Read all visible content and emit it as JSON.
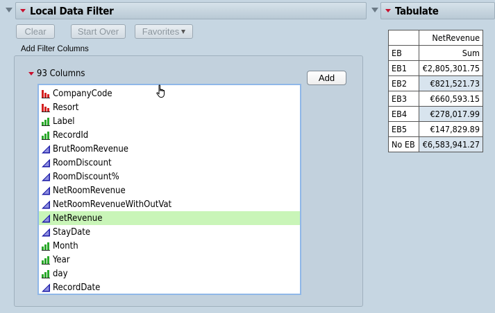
{
  "local_data_filter": {
    "title": "Local Data Filter",
    "buttons": {
      "clear": "Clear",
      "start_over": "Start Over",
      "favorites": "Favorites"
    },
    "add_filter_columns_label": "Add Filter Columns",
    "columns_header": "93 Columns",
    "add_button": "Add",
    "columns": [
      {
        "name": "CompanyCode",
        "type": "nominal-icon"
      },
      {
        "name": "Resort",
        "type": "nominal-icon"
      },
      {
        "name": "Label",
        "type": "ordinal-icon"
      },
      {
        "name": "RecordId",
        "type": "ordinal-icon"
      },
      {
        "name": "BrutRoomRevenue",
        "type": "continuous-icon"
      },
      {
        "name": "RoomDiscount",
        "type": "continuous-icon"
      },
      {
        "name": "RoomDiscount%",
        "type": "continuous-icon"
      },
      {
        "name": "NetRoomRevenue",
        "type": "continuous-icon"
      },
      {
        "name": "NetRoomRevenueWithOutVat",
        "type": "continuous-icon"
      },
      {
        "name": "NetRevenue",
        "type": "continuous-icon",
        "selected": true
      },
      {
        "name": "StayDate",
        "type": "continuous-icon"
      },
      {
        "name": "Month",
        "type": "ordinal-icon"
      },
      {
        "name": "Year",
        "type": "ordinal-icon"
      },
      {
        "name": "day",
        "type": "ordinal-icon"
      },
      {
        "name": "RecordDate",
        "type": "continuous-icon"
      }
    ]
  },
  "tabulate": {
    "title": "Tabulate",
    "column_header": "NetRevenue",
    "row_header": "EB",
    "stat_header": "Sum",
    "rows": [
      {
        "label": "EB1",
        "value": "€2,805,301.75"
      },
      {
        "label": "EB2",
        "value": "€821,521.73"
      },
      {
        "label": "EB3",
        "value": "€660,593.15"
      },
      {
        "label": "EB4",
        "value": "€278,017.99"
      },
      {
        "label": "EB5",
        "value": "€147,829.89"
      },
      {
        "label": "No EB",
        "value": "€6,583,941.27"
      }
    ]
  },
  "colors": {
    "background": "#c6d6e2",
    "selection": "#c9f5b8",
    "red_triangle": "#c8102e",
    "list_focus_border": "#8fb7e8"
  }
}
